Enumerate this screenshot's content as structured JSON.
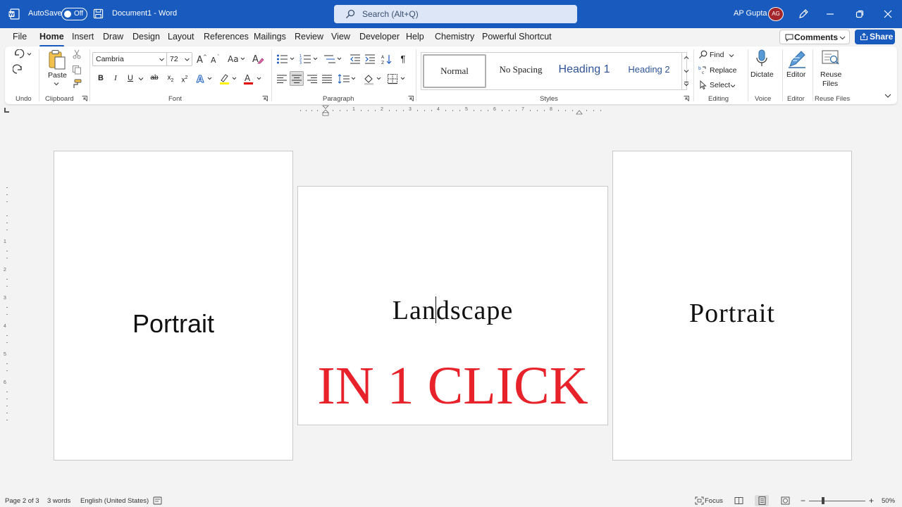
{
  "titlebar": {
    "autosave_label": "AutoSave",
    "autosave_state": "Off",
    "doc_title": "Document1  -  Word",
    "search_placeholder": "Search (Alt+Q)",
    "user_name": "AP Gupta",
    "user_initials": "AG"
  },
  "menu": {
    "tabs": [
      "File",
      "Home",
      "Insert",
      "Draw",
      "Design",
      "Layout",
      "References",
      "Mailings",
      "Review",
      "View",
      "Developer",
      "Help",
      "Chemistry",
      "Powerful Shortcut"
    ],
    "active": "Home",
    "comments_label": "Comments",
    "share_label": "Share"
  },
  "ribbon": {
    "groups": {
      "undo": "Undo",
      "clipboard": "Clipboard",
      "font": "Font",
      "paragraph": "Paragraph",
      "styles": "Styles",
      "editing": "Editing",
      "voice": "Voice",
      "editor": "Editor",
      "reuse": "Reuse Files"
    },
    "paste_label": "Paste",
    "font_name": "Cambria",
    "font_size": "72",
    "styles": [
      "Normal",
      "No Spacing",
      "Heading 1",
      "Heading 2"
    ],
    "find_label": "Find",
    "replace_label": "Replace",
    "select_label": "Select",
    "dictate_label": "Dictate",
    "editor_label": "Editor",
    "reuse_label_1": "Reuse",
    "reuse_label_2": "Files"
  },
  "ruler": {
    "numbers": [
      "1",
      "2",
      "3",
      "4",
      "5",
      "6",
      "7",
      "8"
    ],
    "vnumbers": [
      "1",
      "2",
      "3",
      "4",
      "5",
      "6"
    ]
  },
  "document": {
    "page1_text": "Portrait",
    "page2_text_a": "Lan",
    "page2_text_b": "dscape",
    "page2_overlay": "IN 1 CLICK",
    "page3_text": "Portrait"
  },
  "statusbar": {
    "page_info": "Page 2 of 3",
    "words": "3 words",
    "language": "English (United States)",
    "focus_label": "Focus",
    "zoom_level": "50%",
    "zoom_fraction": 0.25
  },
  "colors": {
    "brand_blue": "#185abd",
    "overlay_red": "#e8222a",
    "avatar_red": "#a4262c"
  }
}
